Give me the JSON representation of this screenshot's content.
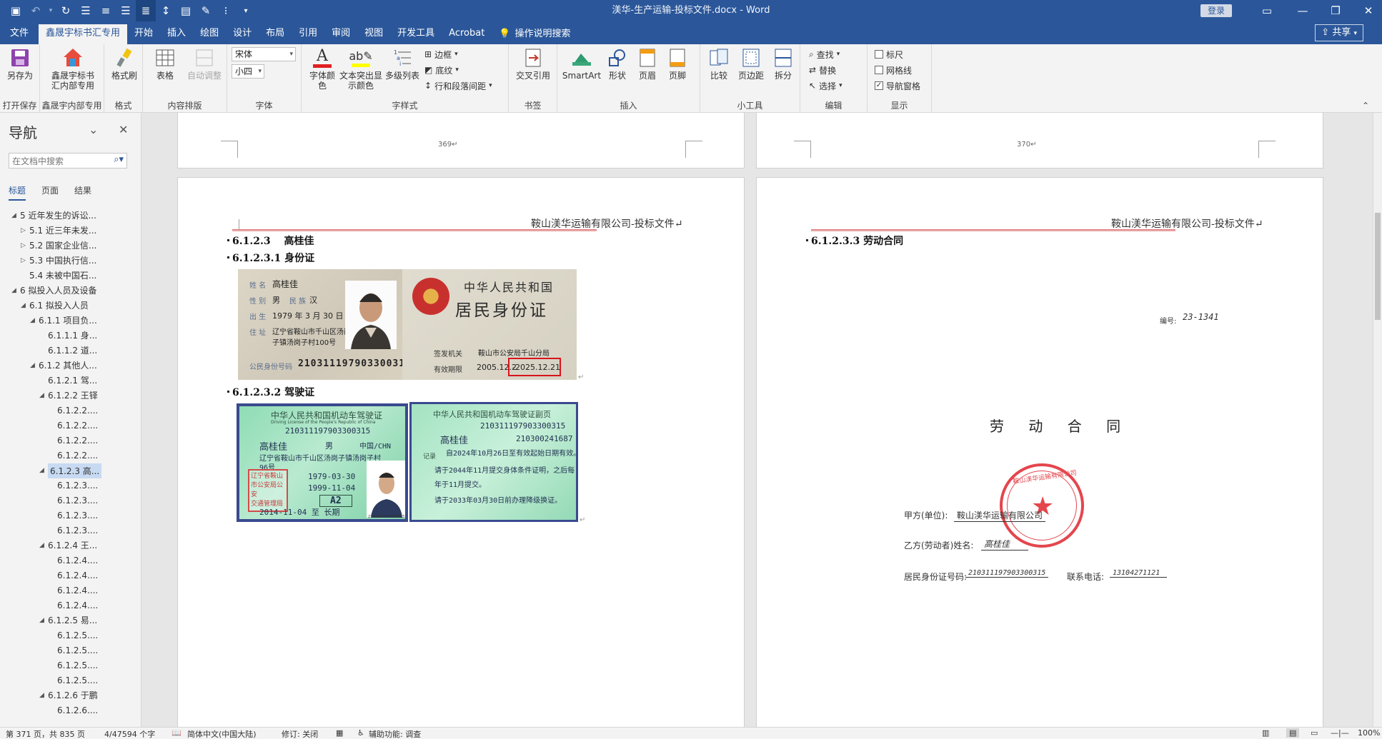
{
  "titlebar": {
    "title": "渼华-生产运输-投标文件.docx  -  Word",
    "login": "登录"
  },
  "tabs": [
    "文件",
    "鑫晟宇标书汇专用",
    "开始",
    "插入",
    "绘图",
    "设计",
    "布局",
    "引用",
    "审阅",
    "视图",
    "开发工具",
    "Acrobat"
  ],
  "tell_me": "操作说明搜索",
  "share": "共享",
  "ribbon": {
    "groups": {
      "open_save": "打开保存",
      "xsy": "鑫晟宇内部专用",
      "format": "格式",
      "layout": "内容排版",
      "font": "字体",
      "char_style": "字样式",
      "bookmark": "书签",
      "insert": "插入",
      "tools": "小工具",
      "edit": "编辑",
      "show": "显示"
    },
    "buttons": {
      "save_as": "另存为",
      "xsy_tool": "鑫晟宇标书汇内部专用",
      "format_painter": "格式刷",
      "table": "表格",
      "auto_adjust": "自动调整",
      "font_color": "字体颜色",
      "highlight": "文本突出显示颜色",
      "multilevel": "多级列表",
      "border": "边框",
      "shading": "底纹",
      "line_spacing": "行和段落间距",
      "cross_ref": "交叉引用",
      "smartart": "SmartArt",
      "shapes": "形状",
      "header": "页眉",
      "footer": "页脚",
      "compare": "比较",
      "margins": "页边距",
      "split": "拆分",
      "find": "查找",
      "replace": "替换",
      "select": "选择",
      "ruler": "标尺",
      "gridlines": "网格线",
      "nav_pane": "导航窗格"
    },
    "font_name": "宋体",
    "font_size": "小四",
    "checks": {
      "ruler": false,
      "gridlines": false,
      "nav_pane": true
    }
  },
  "nav": {
    "title": "导航",
    "search_placeholder": "在文档中搜索",
    "tabs": [
      "标题",
      "页面",
      "结果"
    ],
    "items": [
      {
        "text": "5 近年发生的诉讼...",
        "tri": "open"
      },
      {
        "text": "5.1 近三年未发...",
        "tri": "closed"
      },
      {
        "text": "5.2 国家企业信...",
        "tri": "closed"
      },
      {
        "text": "5.3 中国执行信...",
        "tri": "closed"
      },
      {
        "text": "5.4 未被中国石...",
        "tri": ""
      },
      {
        "text": "6 拟投入人员及设备",
        "tri": "open"
      },
      {
        "text": "6.1 拟投入人员",
        "tri": "open"
      },
      {
        "text": "6.1.1 项目负...",
        "tri": "open"
      },
      {
        "text": "6.1.1.1 身...",
        "tri": ""
      },
      {
        "text": "6.1.1.2 道...",
        "tri": ""
      },
      {
        "text": "6.1.2 其他人...",
        "tri": "open"
      },
      {
        "text": "6.1.2.1 驾...",
        "tri": ""
      },
      {
        "text": "6.1.2.2 王铎",
        "tri": "open"
      },
      {
        "text": "6.1.2.2....",
        "tri": ""
      },
      {
        "text": "6.1.2.2....",
        "tri": ""
      },
      {
        "text": "6.1.2.2....",
        "tri": ""
      },
      {
        "text": "6.1.2.2....",
        "tri": ""
      },
      {
        "text": "6.1.2.3 高...",
        "tri": "open"
      },
      {
        "text": "6.1.2.3....",
        "tri": ""
      },
      {
        "text": "6.1.2.3....",
        "tri": ""
      },
      {
        "text": "6.1.2.3....",
        "tri": ""
      },
      {
        "text": "6.1.2.3....",
        "tri": ""
      },
      {
        "text": "6.1.2.4 王...",
        "tri": "open"
      },
      {
        "text": "6.1.2.4....",
        "tri": ""
      },
      {
        "text": "6.1.2.4....",
        "tri": ""
      },
      {
        "text": "6.1.2.4....",
        "tri": ""
      },
      {
        "text": "6.1.2.4....",
        "tri": ""
      },
      {
        "text": "6.1.2.5 易...",
        "tri": "open"
      },
      {
        "text": "6.1.2.5....",
        "tri": ""
      },
      {
        "text": "6.1.2.5....",
        "tri": ""
      },
      {
        "text": "6.1.2.5....",
        "tri": ""
      },
      {
        "text": "6.1.2.5....",
        "tri": ""
      },
      {
        "text": "6.1.2.6 于鹏",
        "tri": "open"
      },
      {
        "text": "6.1.2.6....",
        "tri": ""
      }
    ],
    "selected_index": 17
  },
  "pages": {
    "left_top_number": "369↵",
    "right_top_number": "370↵",
    "header_text": "鞍山渼华运输有限公司-投标文件↵",
    "left": {
      "h1": "6.1.2.3　  高桂佳",
      "h2": "6.1.2.3.1  身份证",
      "h3": "6.1.2.3.2  驾驶证"
    },
    "right": {
      "h1": "6.1.2.3.3  劳动合同",
      "number_label": "编号:",
      "number_value": "23-1341",
      "title": "劳 动 合 同",
      "party_a_label": "甲方(单位):",
      "party_a_value": "鞍山渼华运输有限公司",
      "party_b_label": "乙方(劳动者)姓名:",
      "party_b_value": "高桂佳",
      "id_label": "居民身份证号码:",
      "id_value": "210311197903300315",
      "phone_label": "联系电话:",
      "phone_value": "13104271121",
      "seal_text": "鞍山渼华运输有限公司"
    }
  },
  "idcard": {
    "name_label": "姓 名",
    "name": "高桂佳",
    "sex_label": "性 别",
    "sex": "男",
    "ethnic_label": "民 族",
    "ethnic": "汉",
    "birth_label": "出 生",
    "birth": "1979 年 3 月 30 日",
    "addr_label": "住 址",
    "addr1": "辽宁省鞍山市千山区汤岗",
    "addr2": "子镇汤岗子村100号",
    "num_label": "公民身份号码",
    "num": "210311197903300315",
    "back_title1": "中华人民共和国",
    "back_title2": "居民身份证",
    "issuer_label": "签发机关",
    "issuer": "鞍山市公安局千山分局",
    "valid_label": "有效期限",
    "valid_from": "2005.12.2",
    "valid_to": "-2025.12.21"
  },
  "license": {
    "title": "中华人民共和国机动车驾驶证",
    "title_en": "Driving License of the People's Republic of China",
    "num": "210311197903300315",
    "name": "高桂佳",
    "sex": "男",
    "nationality": "中国/CHN",
    "address": "辽宁省鞍山市千山区汤岗子镇汤岗子村",
    "address2": "96号",
    "birth": "1979-03-30",
    "first_issue": "1999-11-04",
    "class": "A2",
    "valid": "2014-11-04 至 长期",
    "stamp": [
      "辽宁省鞍山",
      "市公安局公安",
      "交通管理局"
    ],
    "photo_code": "210311197903300315",
    "sub_title": "中华人民共和国机动车驾驶证副页",
    "sub_num": "210311197903300315",
    "sub_name": "高桂佳",
    "file_no": "210300241687",
    "record_label": "记录",
    "record1": "自2024年10月26日至有效起始日期有效。",
    "record2": "请于2044年11月提交身体条件证明，之后每",
    "record3": "年于11月提交。",
    "record4": "请于2033年03月30日前办理降级换证。"
  },
  "status": {
    "page": "第 371 页，共 835 页",
    "words": "4/47594 个字",
    "lang": "简体中文(中国大陆)",
    "track": "修订: 关闭",
    "access": "辅助功能: 调查",
    "zoom": "100%"
  }
}
